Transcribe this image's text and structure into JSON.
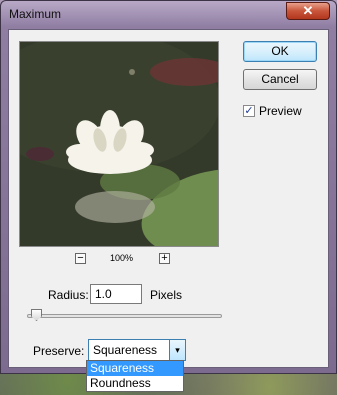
{
  "dialog": {
    "title": "Maximum",
    "close_glyph": "✕",
    "ok_label": "OK",
    "cancel_label": "Cancel",
    "preview_checkbox": {
      "label": "Preview",
      "checked": true,
      "glyph": "✓"
    }
  },
  "zoom": {
    "minus": "−",
    "plus": "+",
    "level": "100%"
  },
  "radius": {
    "label": "Radius:",
    "value": "1.0",
    "unit": "Pixels",
    "slider_fraction": 0.05
  },
  "preserve": {
    "label": "Preserve:",
    "selected": "Squareness",
    "arrow": "▾",
    "options": [
      "Squareness",
      "Roundness"
    ]
  },
  "colors": {
    "accent": "#3399ff",
    "title_bar": "#8f7ea2",
    "close": "#c8553a"
  }
}
